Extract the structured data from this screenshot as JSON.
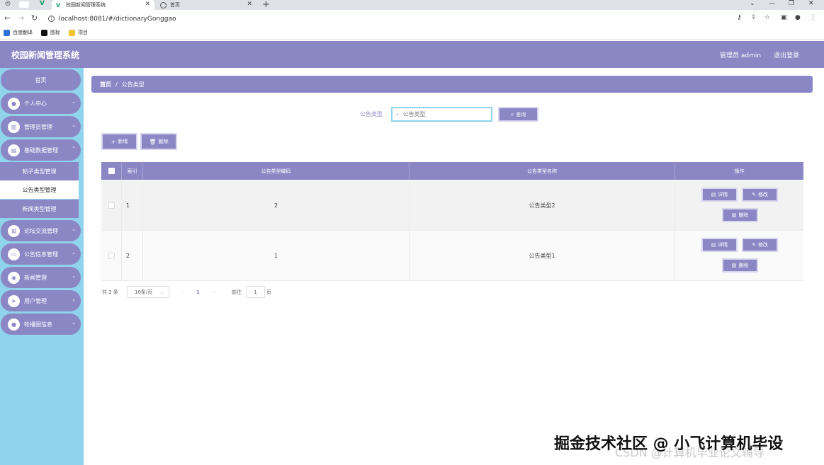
{
  "browser": {
    "tabs": [
      {
        "label": "校园新闻管理系统",
        "active": true
      },
      {
        "label": "首页",
        "active": false
      }
    ],
    "new_tab": "+",
    "url": "localhost:8081/#/dictionaryGonggao",
    "bookmarks": [
      "百度翻译",
      "图标",
      "项目"
    ]
  },
  "header": {
    "title": "校园新闻管理系统",
    "user": "管理员 admin",
    "logout": "退出登录"
  },
  "sidebar": {
    "home": "首页",
    "menus": [
      {
        "label": "个人中心",
        "icon": "person-icon"
      },
      {
        "label": "管理员管理",
        "icon": "book-icon"
      },
      {
        "label": "基础数据管理",
        "icon": "trash-icon"
      },
      {
        "label": "论坛交流管理",
        "icon": "grid-icon"
      },
      {
        "label": "公告信息管理",
        "icon": "ticket-icon"
      },
      {
        "label": "新闻管理",
        "icon": "location-icon"
      },
      {
        "label": "用户管理",
        "icon": "send-icon"
      },
      {
        "label": "轮播图信息",
        "icon": "person-icon"
      }
    ],
    "sub_items": [
      {
        "label": "帖子类型管理",
        "active": false
      },
      {
        "label": "公告类型管理",
        "active": true
      },
      {
        "label": "新闻类型管理",
        "active": false
      }
    ]
  },
  "breadcrumb": {
    "home": "首页",
    "separator": "/",
    "current": "公告类型"
  },
  "search": {
    "label": "公告类型",
    "placeholder": "公告类型",
    "button": "查询"
  },
  "toolbar": {
    "add": "新增",
    "delete": "删除"
  },
  "table": {
    "headers": [
      "索引",
      "公告类型编码",
      "公告类型名称",
      "操作"
    ],
    "rows": [
      {
        "index": "1",
        "code": "2",
        "name": "公告类型2"
      },
      {
        "index": "2",
        "code": "1",
        "name": "公告类型1"
      }
    ],
    "actions": {
      "detail": "详情",
      "edit": "修改",
      "delete": "删除"
    }
  },
  "pagination": {
    "total": "共 2 条",
    "page_size": "10条/页",
    "current_page": "1",
    "goto_label": "前往",
    "goto_value": "1",
    "page_suffix": "页"
  },
  "watermark": {
    "main": "掘金技术社区 @ 小飞计算机毕设",
    "sub": "CSDN @计算机毕业论文辅导"
  },
  "colors": {
    "primary": "#8b87c5",
    "sidebar_bg": "#8fd3ec"
  }
}
